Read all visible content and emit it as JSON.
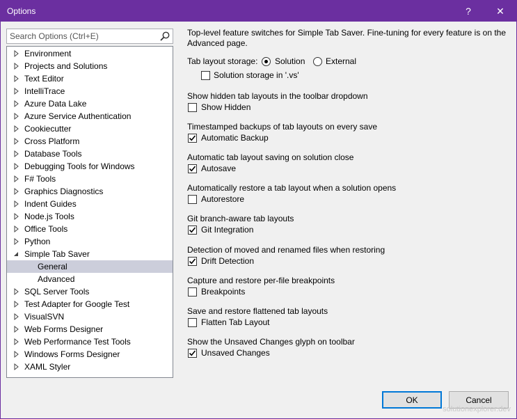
{
  "window": {
    "title": "Options",
    "help_glyph": "?",
    "close_glyph": "✕"
  },
  "search": {
    "placeholder": "Search Options (Ctrl+E)"
  },
  "tree": {
    "items": [
      {
        "label": "Environment",
        "level": 0,
        "expanded": false
      },
      {
        "label": "Projects and Solutions",
        "level": 0,
        "expanded": false
      },
      {
        "label": "Text Editor",
        "level": 0,
        "expanded": false
      },
      {
        "label": "IntelliTrace",
        "level": 0,
        "expanded": false
      },
      {
        "label": "Azure Data Lake",
        "level": 0,
        "expanded": false
      },
      {
        "label": "Azure Service Authentication",
        "level": 0,
        "expanded": false
      },
      {
        "label": "Cookiecutter",
        "level": 0,
        "expanded": false
      },
      {
        "label": "Cross Platform",
        "level": 0,
        "expanded": false
      },
      {
        "label": "Database Tools",
        "level": 0,
        "expanded": false
      },
      {
        "label": "Debugging Tools for Windows",
        "level": 0,
        "expanded": false
      },
      {
        "label": "F# Tools",
        "level": 0,
        "expanded": false
      },
      {
        "label": "Graphics Diagnostics",
        "level": 0,
        "expanded": false
      },
      {
        "label": "Indent Guides",
        "level": 0,
        "expanded": false
      },
      {
        "label": "Node.js Tools",
        "level": 0,
        "expanded": false
      },
      {
        "label": "Office Tools",
        "level": 0,
        "expanded": false
      },
      {
        "label": "Python",
        "level": 0,
        "expanded": false
      },
      {
        "label": "Simple Tab Saver",
        "level": 0,
        "expanded": true
      },
      {
        "label": "General",
        "level": 1,
        "selected": true
      },
      {
        "label": "Advanced",
        "level": 1
      },
      {
        "label": "SQL Server Tools",
        "level": 0,
        "expanded": false
      },
      {
        "label": "Test Adapter for Google Test",
        "level": 0,
        "expanded": false
      },
      {
        "label": "VisualSVN",
        "level": 0,
        "expanded": false
      },
      {
        "label": "Web Forms Designer",
        "level": 0,
        "expanded": false
      },
      {
        "label": "Web Performance Test Tools",
        "level": 0,
        "expanded": false
      },
      {
        "label": "Windows Forms Designer",
        "level": 0,
        "expanded": false
      },
      {
        "label": "XAML Styler",
        "level": 0,
        "expanded": false
      }
    ]
  },
  "page": {
    "description": "Top-level feature switches for Simple Tab Saver. Fine-tuning for every feature is on the Advanced page.",
    "storage": {
      "label": "Tab layout storage:",
      "options": [
        {
          "label": "Solution",
          "selected": true
        },
        {
          "label": "External",
          "selected": false
        }
      ],
      "vs_checkbox": {
        "label": "Solution storage in '.vs'",
        "checked": false
      }
    },
    "settings": [
      {
        "heading": "Show hidden tab layouts in the toolbar dropdown",
        "label": "Show Hidden",
        "checked": false
      },
      {
        "heading": "Timestamped backups of tab layouts on every save",
        "label": "Automatic Backup",
        "checked": true
      },
      {
        "heading": "Automatic tab layout saving on solution close",
        "label": "Autosave",
        "checked": true
      },
      {
        "heading": "Automatically restore a tab layout when a solution opens",
        "label": "Autorestore",
        "checked": false
      },
      {
        "heading": "Git branch-aware tab layouts",
        "label": "Git Integration",
        "checked": true
      },
      {
        "heading": "Detection of moved and renamed files when restoring",
        "label": "Drift Detection",
        "checked": true
      },
      {
        "heading": "Capture and restore per-file breakpoints",
        "label": "Breakpoints",
        "checked": false
      },
      {
        "heading": "Save and restore flattened tab layouts",
        "label": "Flatten Tab Layout",
        "checked": false
      },
      {
        "heading": "Show the Unsaved Changes glyph on toolbar",
        "label": "Unsaved Changes",
        "checked": true
      }
    ]
  },
  "buttons": {
    "ok": "OK",
    "cancel": "Cancel"
  },
  "watermark": "solutionexplorer.dev",
  "colors": {
    "titlebar": "#6b2fa0",
    "selection": "#cccedb",
    "default_button_border": "#0078d7"
  }
}
